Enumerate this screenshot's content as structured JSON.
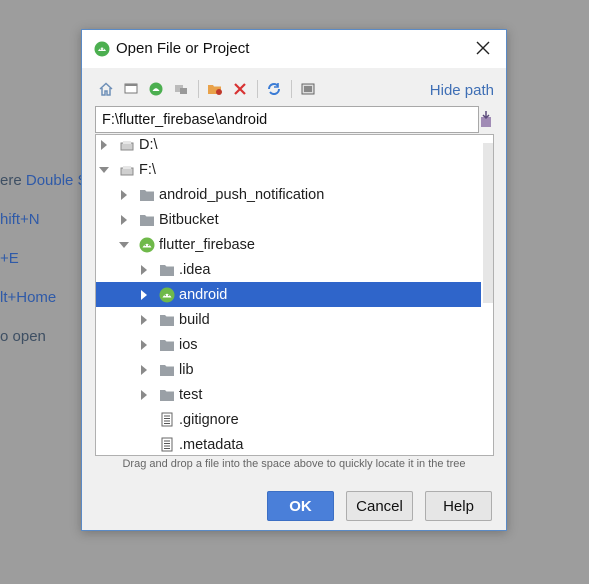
{
  "background": {
    "hints": [
      {
        "prefix": "ere ",
        "key": "Double S"
      },
      {
        "prefix": "",
        "key": "hift+N"
      },
      {
        "prefix": "",
        "key": "+E"
      },
      {
        "prefix": "",
        "key": "lt+Home"
      },
      {
        "prefix": "o open",
        "key": ""
      }
    ]
  },
  "dialog": {
    "title": "Open File or Project",
    "hide_path_label": "Hide path",
    "path_value": "F:\\flutter_firebase\\android",
    "drag_hint": "Drag and drop a file into the space above to quickly locate it in the tree",
    "buttons": {
      "ok": "OK",
      "cancel": "Cancel",
      "help": "Help"
    }
  },
  "toolbar": {
    "icons": [
      "home-icon",
      "desktop-icon",
      "project-icon",
      "module-icon",
      "new-folder-icon",
      "delete-icon",
      "refresh-icon",
      "show-hidden-icon"
    ]
  },
  "tree": {
    "items": [
      {
        "label": "D:\\",
        "level": 0,
        "expanded": false,
        "icon": "drive-icon",
        "arrow": "right"
      },
      {
        "label": "F:\\",
        "level": 0,
        "expanded": true,
        "icon": "drive-icon",
        "arrow": "down"
      },
      {
        "label": "android_push_notification",
        "level": 1,
        "icon": "folder-icon",
        "arrow": "right"
      },
      {
        "label": "Bitbucket",
        "level": 1,
        "icon": "folder-icon",
        "arrow": "right"
      },
      {
        "label": "flutter_firebase",
        "level": 1,
        "icon": "android-project-icon",
        "arrow": "down"
      },
      {
        "label": ".idea",
        "level": 2,
        "icon": "folder-icon",
        "arrow": "right"
      },
      {
        "label": "android",
        "level": 2,
        "icon": "android-project-icon",
        "arrow": "right",
        "selected": true
      },
      {
        "label": "build",
        "level": 2,
        "icon": "folder-icon",
        "arrow": "right"
      },
      {
        "label": "ios",
        "level": 2,
        "icon": "folder-icon",
        "arrow": "right"
      },
      {
        "label": "lib",
        "level": 2,
        "icon": "folder-icon",
        "arrow": "right"
      },
      {
        "label": "test",
        "level": 2,
        "icon": "folder-icon",
        "arrow": "right"
      },
      {
        "label": ".gitignore",
        "level": 2,
        "icon": "file-icon",
        "arrow": "none"
      },
      {
        "label": ".metadata",
        "level": 2,
        "icon": "file-icon",
        "arrow": "none"
      }
    ]
  },
  "colors": {
    "accent": "#3f6fb5",
    "selection": "#2f65ca",
    "ok_button": "#4a7fd9"
  }
}
